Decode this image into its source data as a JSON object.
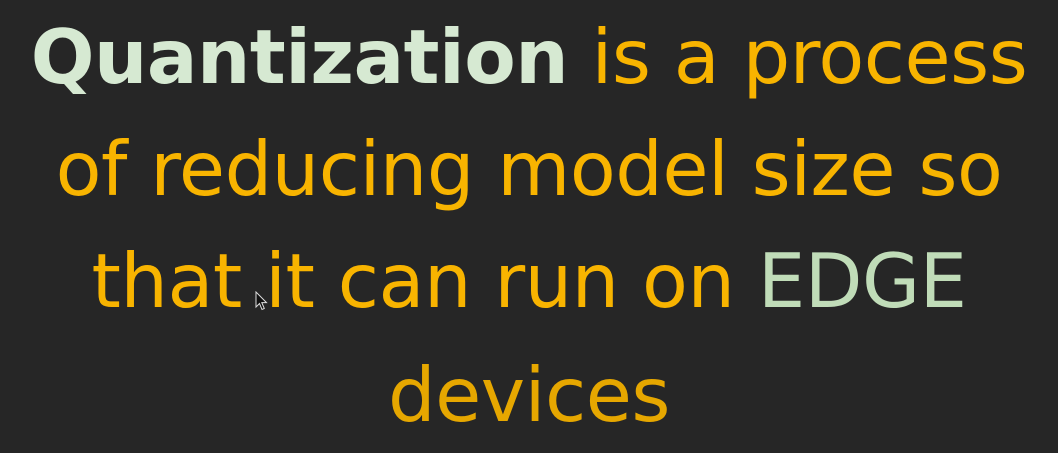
{
  "slide": {
    "line1": {
      "highlight": "Quantization",
      "rest": " is a process"
    },
    "line2": {
      "text": "of reducing model size so"
    },
    "line3": {
      "prefix": "that it can run on ",
      "highlight": "EDGE"
    },
    "line4": {
      "text": "devices"
    }
  },
  "colors": {
    "background": "#262626",
    "text_main": "#f8b400",
    "text_highlight": "#d6e9d2",
    "text_edge": "#c0dcb8"
  },
  "icons": {
    "cursor": "mouse-pointer-icon"
  }
}
